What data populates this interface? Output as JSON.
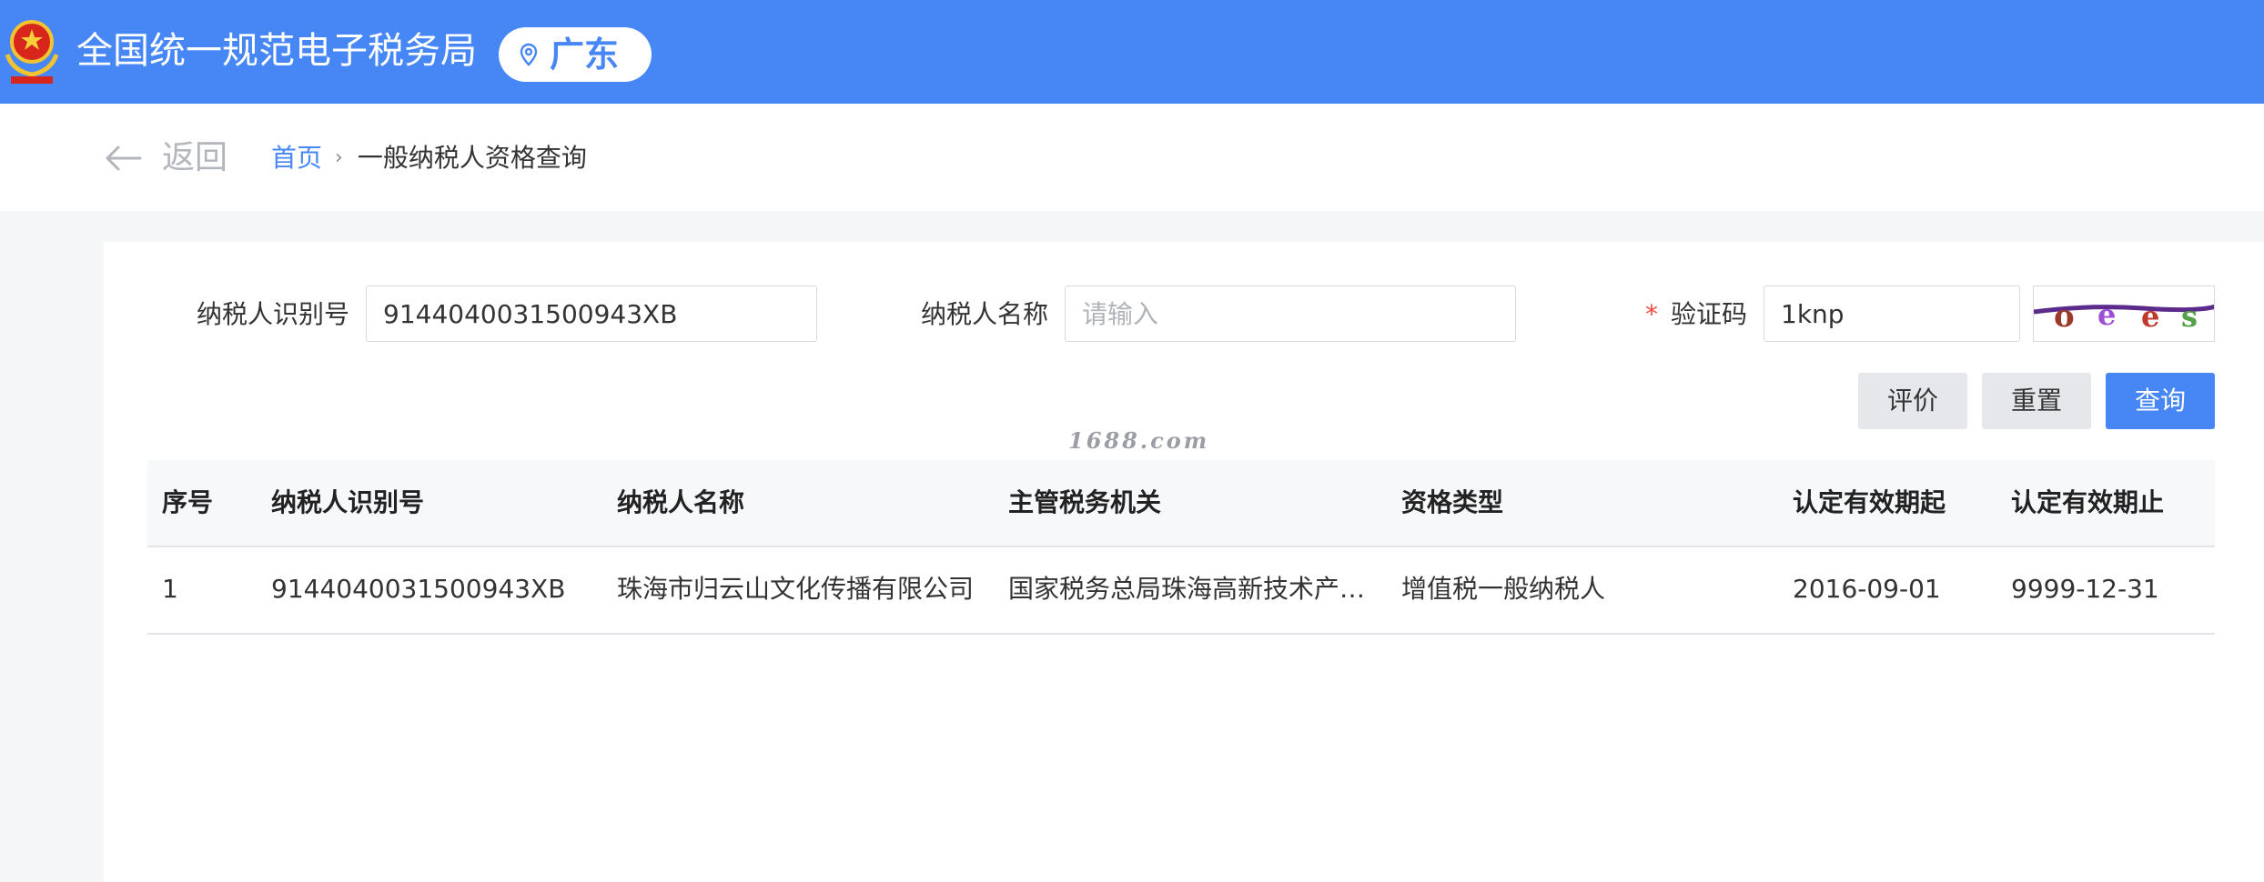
{
  "header": {
    "site_title": "全国统一规范电子税务局",
    "region": "广东",
    "icons": {
      "emblem": "national-emblem-icon",
      "location": "location-pin-icon"
    }
  },
  "nav": {
    "back_label": "返回",
    "breadcrumb": {
      "home": "首页",
      "separator": "›",
      "current": "一般纳税人资格查询"
    }
  },
  "form": {
    "taxpayer_id_label": "纳税人识别号",
    "taxpayer_id_value": "9144040031500943XB",
    "taxpayer_name_label": "纳税人名称",
    "taxpayer_name_placeholder": "请输入",
    "captcha_required_mark": "*",
    "captcha_label": "验证码",
    "captcha_value": "1knp",
    "buttons": {
      "evaluate": "评价",
      "reset": "重置",
      "query": "查询"
    }
  },
  "watermark": "1688.com",
  "table": {
    "columns": [
      "序号",
      "纳税人识别号",
      "纳税人名称",
      "主管税务机关",
      "资格类型",
      "认定有效期起",
      "认定有效期止"
    ],
    "rows": [
      [
        "1",
        "9144040031500943XB",
        "珠海市归云山文化传播有限公司",
        "国家税务总局珠海高新技术产…",
        "增值税一般纳税人",
        "2016-09-01",
        "9999-12-31"
      ]
    ]
  },
  "colors": {
    "brand_blue": "#4687f5",
    "required_red": "#e94b3c",
    "page_bg": "#f5f6f7"
  }
}
